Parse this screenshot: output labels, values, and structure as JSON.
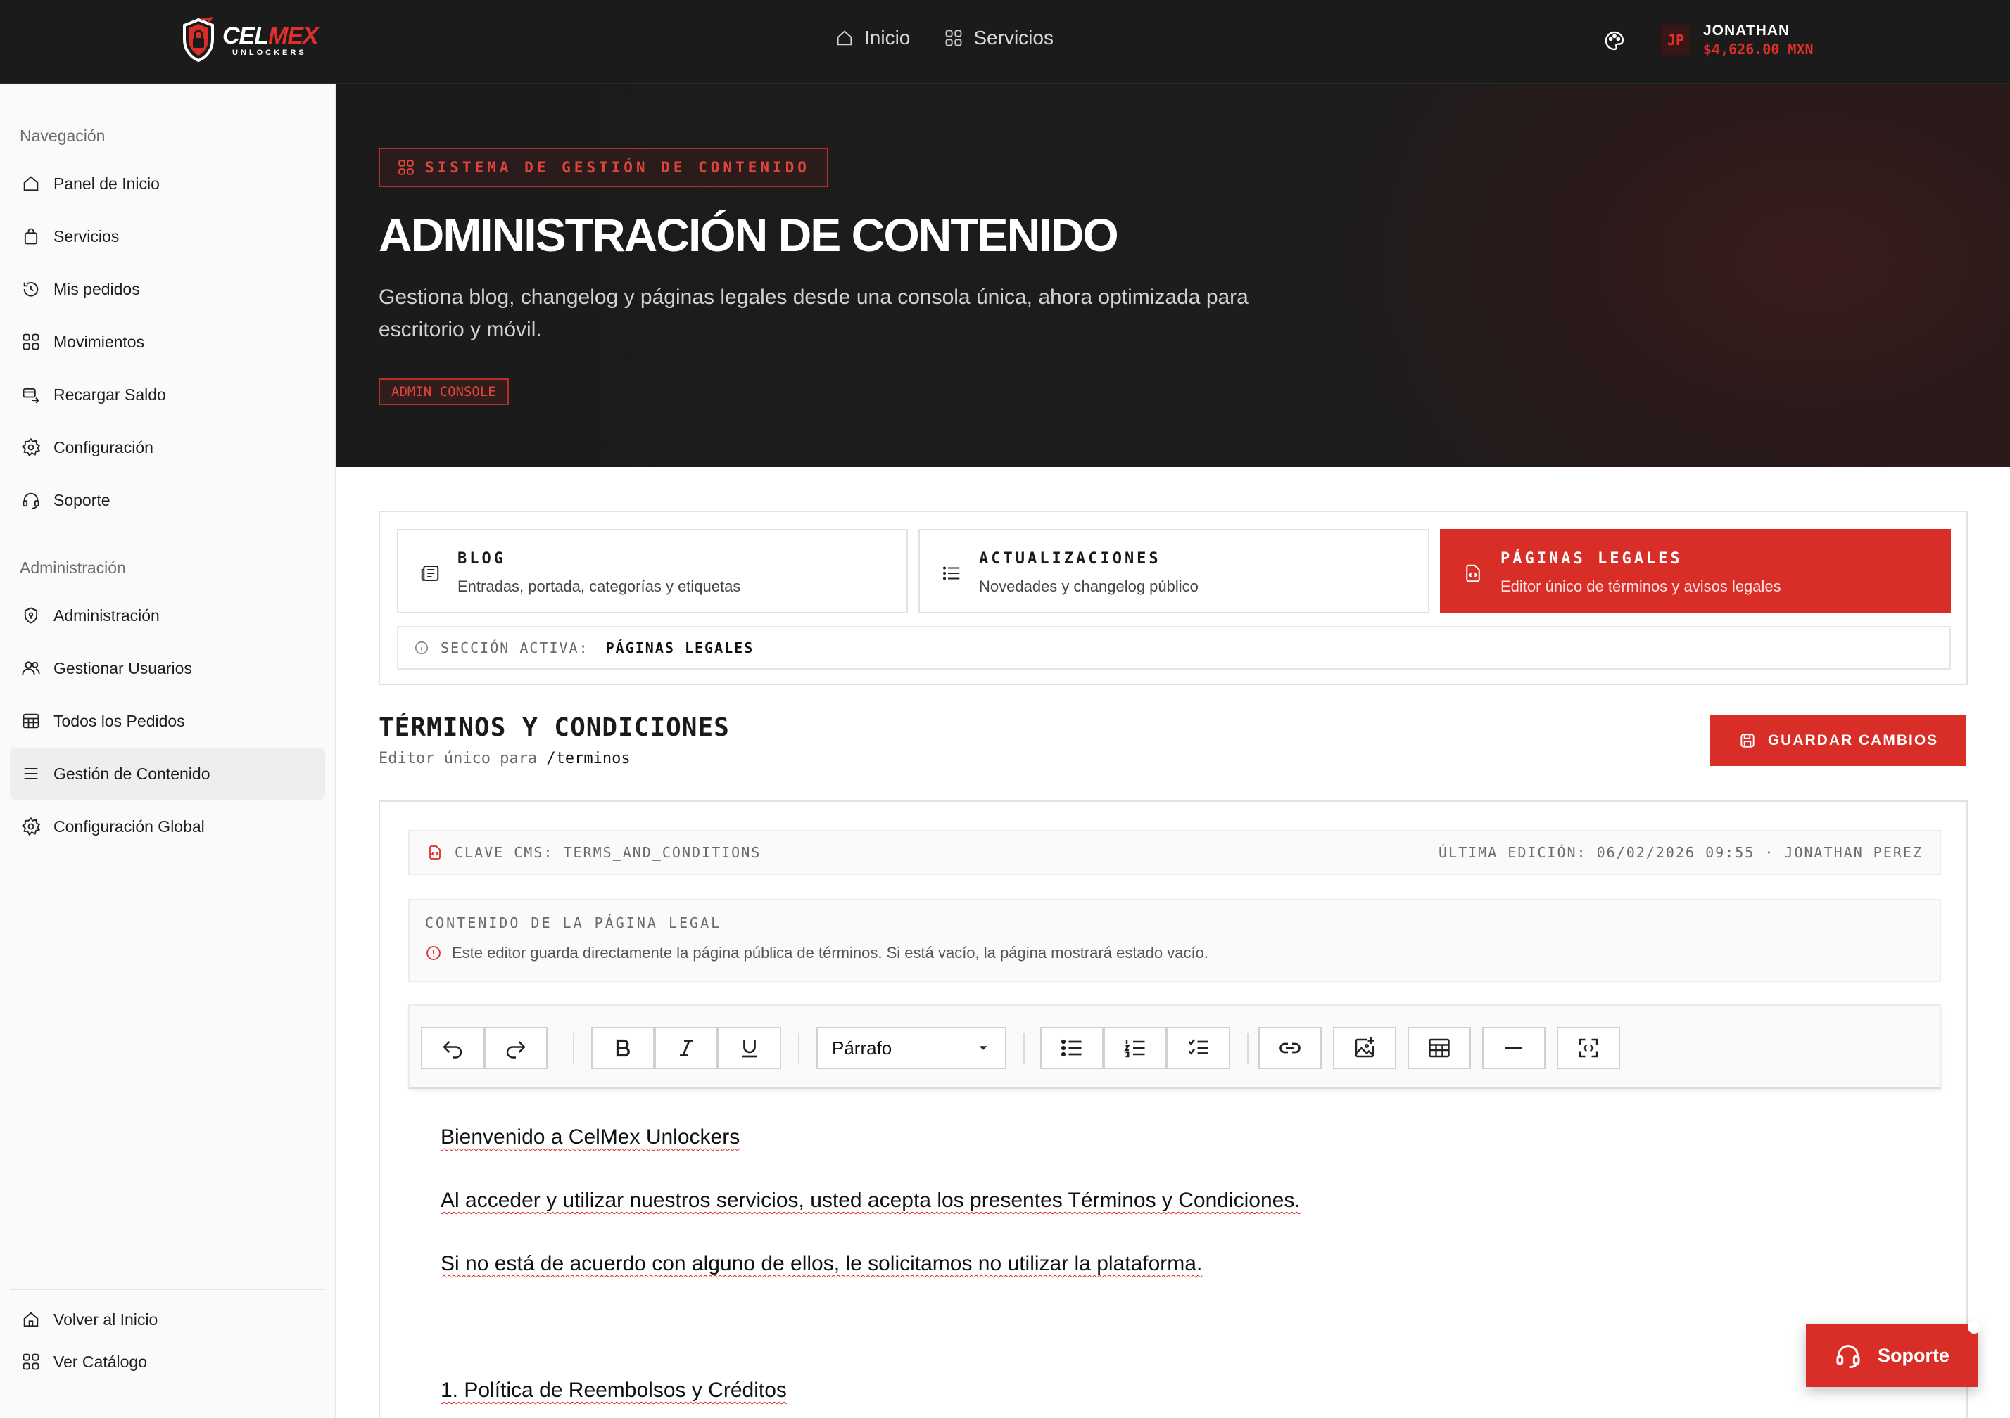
{
  "brand": {
    "name_white": "CEL",
    "name_red": "MEX",
    "tagline": "UNLOCKERS",
    "accent_color": "#d92e28"
  },
  "topnav": {
    "items": [
      {
        "label": "Inicio",
        "icon": "home-icon"
      },
      {
        "label": "Servicios",
        "icon": "grid-icon"
      }
    ]
  },
  "user": {
    "initials": "JP",
    "name": "JONATHAN",
    "balance": "$4,626.00 MXN"
  },
  "sidebar": {
    "nav_title": "Navegación",
    "nav_items": [
      {
        "label": "Panel de Inicio",
        "icon": "home-icon"
      },
      {
        "label": "Servicios",
        "icon": "shopping-bag-icon"
      },
      {
        "label": "Mis pedidos",
        "icon": "history-icon"
      },
      {
        "label": "Movimientos",
        "icon": "grid-icon"
      },
      {
        "label": "Recargar Saldo",
        "icon": "recharge-icon"
      },
      {
        "label": "Configuración",
        "icon": "gear-icon"
      },
      {
        "label": "Soporte",
        "icon": "headset-icon"
      }
    ],
    "admin_title": "Administración",
    "admin_items": [
      {
        "label": "Administración",
        "icon": "shield-icon"
      },
      {
        "label": "Gestionar Usuarios",
        "icon": "users-icon"
      },
      {
        "label": "Todos los Pedidos",
        "icon": "table-icon"
      },
      {
        "label": "Gestión de Contenido",
        "icon": "list-icon",
        "active": true
      },
      {
        "label": "Configuración Global",
        "icon": "gear-icon"
      }
    ],
    "footer_items": [
      {
        "label": "Volver al Inicio",
        "icon": "home-icon"
      },
      {
        "label": "Ver Catálogo",
        "icon": "grid-icon"
      }
    ]
  },
  "hero": {
    "tag": "SISTEMA DE GESTIÓN DE CONTENIDO",
    "title": "ADMINISTRACIÓN DE CONTENIDO",
    "description": "Gestiona blog, changelog y páginas legales desde una consola única, ahora optimizada para escritorio y móvil.",
    "badge": "ADMIN CONSOLE"
  },
  "tabs": [
    {
      "title": "BLOG",
      "subtitle": "Entradas, portada, categorías y etiquetas",
      "icon": "newspaper-icon"
    },
    {
      "title": "ACTUALIZACIONES",
      "subtitle": "Novedades y changelog público",
      "icon": "list-icon"
    },
    {
      "title": "PÁGINAS LEGALES",
      "subtitle": "Editor único de términos y avisos legales",
      "icon": "legal-page-icon",
      "active": true
    }
  ],
  "active_section": {
    "label": "SECCIÓN ACTIVA:",
    "value": "PÁGINAS LEGALES"
  },
  "section": {
    "title": "TÉRMINOS Y CONDICIONES",
    "subtitle_prefix": "Editor único para",
    "subtitle_path": "/terminos",
    "save_label": "GUARDAR CAMBIOS"
  },
  "editor": {
    "cms_key": "CLAVE CMS: TERMS_AND_CONDITIONS",
    "last_edit": "ÚLTIMA EDICIÓN: 06/02/2026 09:55 · JONATHAN PEREZ",
    "info_title": "CONTENIDO DE LA PÁGINA LEGAL",
    "info_note": "Este editor guarda directamente la página pública de términos. Si está vacío, la página mostrará estado vacío.",
    "block_format": "Párrafo",
    "content": [
      "Bienvenido a CelMex Unlockers",
      "Al acceder y utilizar nuestros servicios, usted acepta los presentes Términos y Condiciones.",
      "Si no está de acuerdo con alguno de ellos, le solicitamos no utilizar la plataforma.",
      "1. Política de Reembolsos y Créditos"
    ]
  },
  "support_button": {
    "label": "Soporte",
    "icon": "headset-icon"
  }
}
